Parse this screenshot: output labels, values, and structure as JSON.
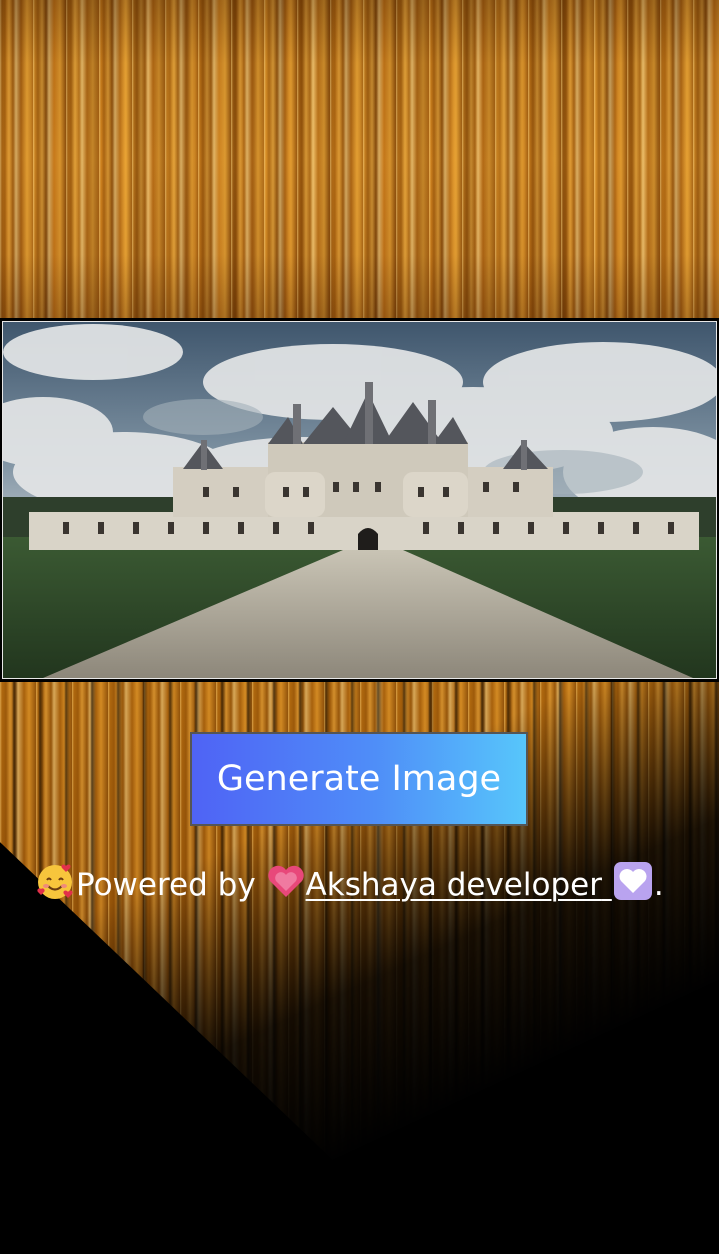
{
  "button": {
    "label": "Generate Image"
  },
  "credit": {
    "prefix": "Powered by",
    "link_text": "Akshaya developer",
    "suffix": ".",
    "icons": [
      "smiling-face-with-hearts-emoji",
      "growing-heart-emoji",
      "white-heart-emoji"
    ]
  },
  "colors": {
    "button_gradient_start": "#4f63f5",
    "button_gradient_end": "#57c6fb",
    "background_gold": "#c67a1a",
    "text": "#ffffff"
  }
}
